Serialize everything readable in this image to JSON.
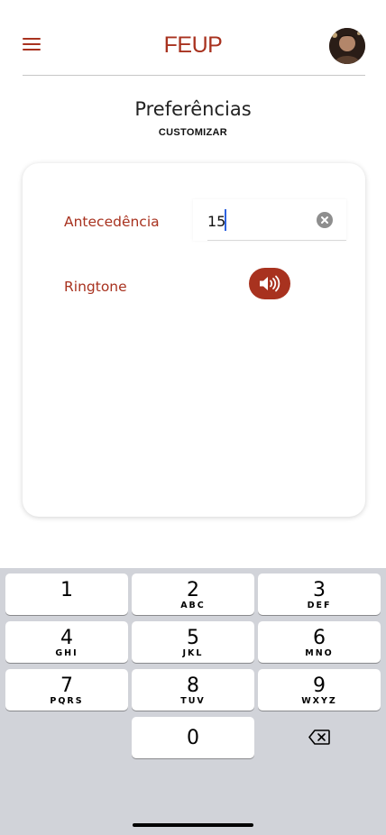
{
  "header": {
    "logo": "FEUP",
    "menu_icon": "hamburger-menu-icon",
    "avatar_icon": "user-avatar"
  },
  "page": {
    "title": "Preferências",
    "subtitle": "CUSTOMIZAR"
  },
  "settings": {
    "antecedencia": {
      "label": "Antecedência",
      "value": "15"
    },
    "ringtone": {
      "label": "Ringtone",
      "icon": "volume-icon"
    }
  },
  "colors": {
    "accent": "#a8321f",
    "caret": "#2d62e0",
    "keyboard_bg": "#d1d3d9"
  },
  "keyboard": {
    "keys": [
      {
        "num": "1",
        "letters": ""
      },
      {
        "num": "2",
        "letters": "ABC"
      },
      {
        "num": "3",
        "letters": "DEF"
      },
      {
        "num": "4",
        "letters": "GHI"
      },
      {
        "num": "5",
        "letters": "JKL"
      },
      {
        "num": "6",
        "letters": "MNO"
      },
      {
        "num": "7",
        "letters": "PQRS"
      },
      {
        "num": "8",
        "letters": "TUV"
      },
      {
        "num": "9",
        "letters": "WXYZ"
      },
      {
        "num": "0",
        "letters": ""
      }
    ],
    "backspace_icon": "backspace-icon"
  }
}
